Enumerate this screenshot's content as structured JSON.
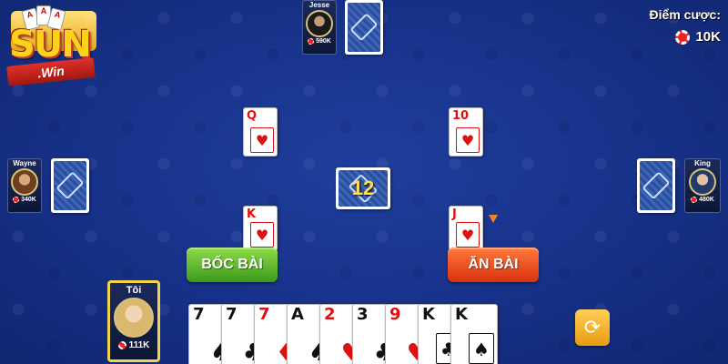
{
  "brand": {
    "logo_text": "SUN",
    "logo_sub": ".Win"
  },
  "bet": {
    "label": "Điểm cược:",
    "amount": "10K"
  },
  "players": {
    "top": {
      "name": "Jesse",
      "money": "590K"
    },
    "left": {
      "name": "Wayne",
      "money": "340K"
    },
    "right": {
      "name": "King",
      "money": "480K"
    },
    "me": {
      "name": "Tôi",
      "money": "111K"
    }
  },
  "deck": {
    "count": "12"
  },
  "table_cards": {
    "top_left": {
      "rank": "Q",
      "suit": "♥"
    },
    "top_right": {
      "rank": "10",
      "suit": "♥"
    },
    "bottom_left": {
      "rank": "K",
      "suit": "♥"
    },
    "bottom_right": {
      "rank": "J",
      "suit": "♥"
    }
  },
  "buttons": {
    "draw": "BỐC BÀI",
    "eat": "ĂN BÀI"
  },
  "hand": [
    {
      "rank": "7",
      "suit": "♠",
      "color": "black"
    },
    {
      "rank": "7",
      "suit": "♣",
      "color": "black"
    },
    {
      "rank": "7",
      "suit": "♦",
      "color": "red"
    },
    {
      "rank": "A",
      "suit": "♠",
      "color": "black"
    },
    {
      "rank": "2",
      "suit": "♥",
      "color": "red"
    },
    {
      "rank": "3",
      "suit": "♣",
      "color": "black"
    },
    {
      "rank": "9",
      "suit": "♥",
      "color": "red"
    },
    {
      "rank": "K",
      "suit": "♣",
      "color": "black"
    },
    {
      "rank": "K",
      "suit": "♠",
      "color": "black"
    }
  ],
  "icons": {
    "sort": "refresh-icon",
    "chip": "chip-icon"
  }
}
